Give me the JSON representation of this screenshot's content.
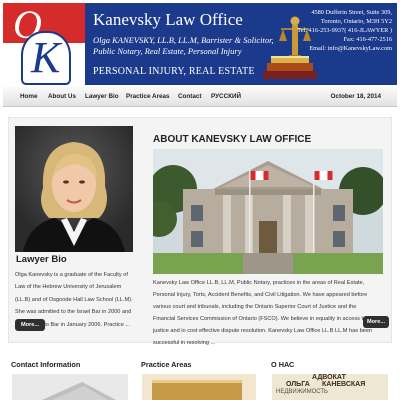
{
  "header": {
    "logo_letters": "OK",
    "title": "Kanevsky Law Office",
    "subtitle_line1": "Olga KANEVSKY, LL.B, LL.M, Barrister & Solicitor,",
    "subtitle_line2": "Public Notary, Real Estate, Personal Injury",
    "tagline": "PERSONAL INJURY, REAL ESTATE",
    "contact": {
      "street": "4580 Dufferin Street, Suite 309,",
      "city": "Toronto, Ontario, M3H 5Y2",
      "tel": "Tel: 416-253-9937( 416-JLAWYER )",
      "fax": "Fax: 416-477-2516",
      "email": "Email: info@KanevskyLaw.com"
    }
  },
  "nav": {
    "items": [
      "Home",
      "About Us",
      "Lawyer Bio",
      "Practice Areas",
      "Contact",
      "РУССКИЙ"
    ],
    "date": "October 18, 2014"
  },
  "sidebar": {
    "title": "Lawyer Bio",
    "text": "Olga Kanevsky is a graduate of the Faculty of Law of the Hebrew University of Jerusalem (LL.B) and of Osgoode Hall Law School (LL.M). She was admitted to the Israel Bar in 2000 and to the Ontario Bar in January 2006. Practice ...",
    "more_label": "More..."
  },
  "main": {
    "title": "ABOUT KANEVSKY LAW OFFICE",
    "text": "Kanevsky Law Office LL.B, LL.M, Public Notary, practices in the areas of Real Estate, Personal Injury, Torts, Accident Benefits, and Civil Litigation. We have appeared before various court and tribunals, including the Ontario Superior Court of Justice and the Financial Services Commission of Ontario (FSCO). We believe in equality in access to justice and in cost effective dispute resolution. Kanevsky Law Office LL.B LL.M has been successful in resolving ...",
    "more_label": "More..."
  },
  "bottom": {
    "col1_title": "Contact Information",
    "col2_title": "Practice Areas",
    "col3_title": "О НАС",
    "col3_words": [
      "АДВОКАТ",
      "ОЛЬГА",
      "КАНЕВСКАЯ",
      "НЕДВИЖИМОСТЬ"
    ]
  },
  "colors": {
    "header_blue": "#1c3a8c",
    "logo_red": "#d52b2b",
    "button_dark": "#2f2f2f"
  }
}
